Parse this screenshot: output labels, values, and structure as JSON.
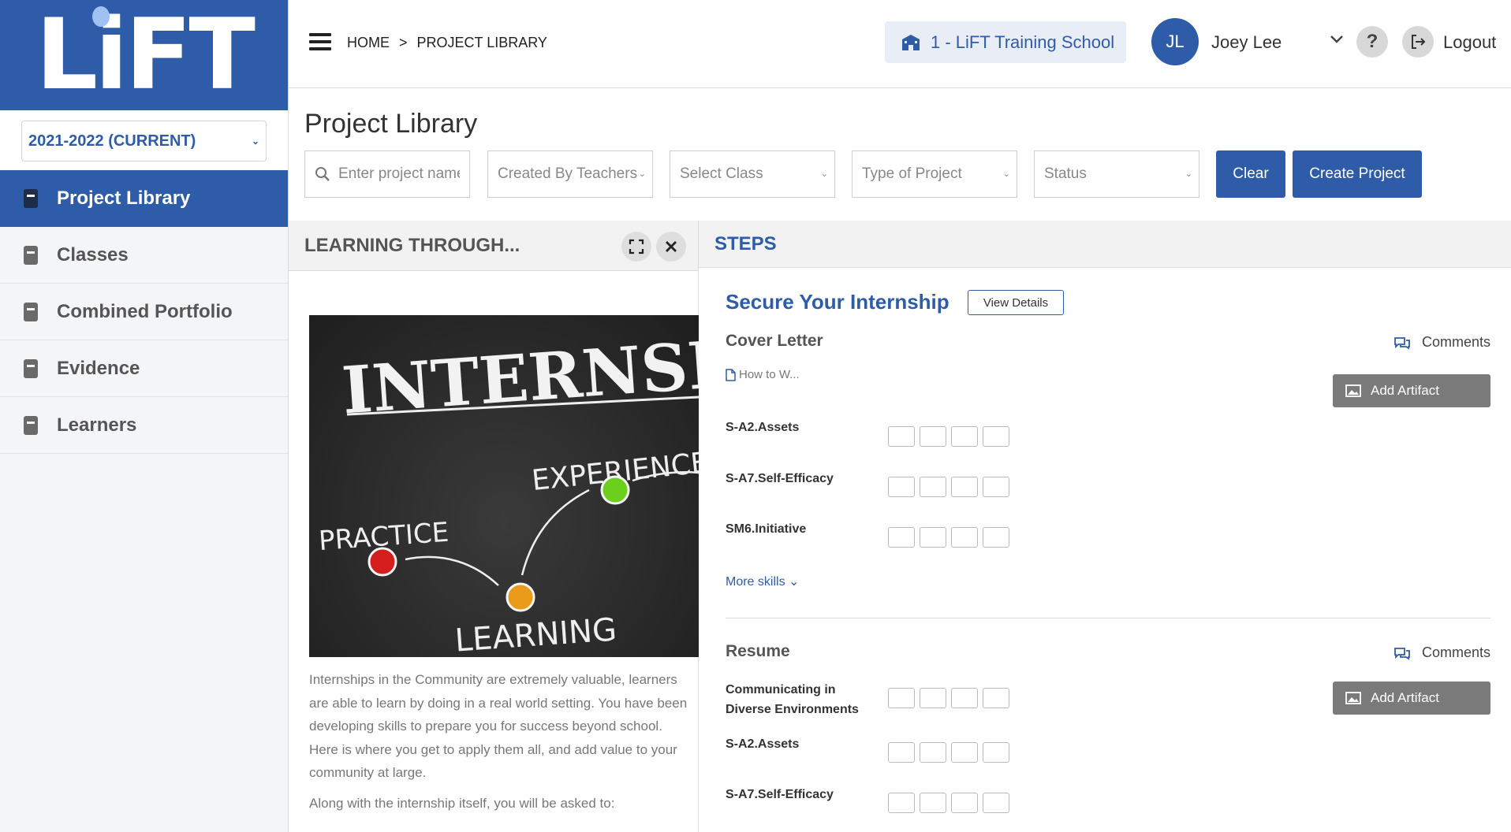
{
  "app": {
    "logo_text": "LiFT"
  },
  "sidebar": {
    "year": "2021-2022 (CURRENT)",
    "items": [
      {
        "label": "Project Library",
        "active": true
      },
      {
        "label": "Classes",
        "active": false
      },
      {
        "label": "Combined Portfolio",
        "active": false
      },
      {
        "label": "Evidence",
        "active": false
      },
      {
        "label": "Learners",
        "active": false
      }
    ]
  },
  "header": {
    "breadcrumb": [
      "HOME",
      ">",
      "PROJECT LIBRARY"
    ],
    "school": "1 - LiFT Training School",
    "user_initials": "JL",
    "user_name": "Joey Lee",
    "help": "?",
    "logout": "Logout"
  },
  "page": {
    "title": "Project Library",
    "filters": {
      "search_placeholder": "Enter project name",
      "created_by": "Created By Teachers",
      "class": "Select Class",
      "type": "Type of Project",
      "status": "Status"
    },
    "clear_label": "Clear",
    "create_label": "Create Project"
  },
  "left_panel": {
    "title": "LEARNING THROUGH...",
    "image_words": {
      "main": "INTERNSHIP",
      "practice": "PRACTICE",
      "experience": "EXPERIENCE",
      "learning": "LEARNING"
    },
    "description": "Internships in the Community are extremely valuable, learners are able to learn by doing in a real world setting. You have been developing skills to prepare you for success beyond school. Here is where you get to apply them all, and add value to your community at large.",
    "description2": "Along with the internship itself, you will be asked to:"
  },
  "steps": {
    "header": "STEPS",
    "step_title": "Secure Your Internship",
    "view_details": "View Details",
    "sections": [
      {
        "title": "Cover Letter",
        "comments": "Comments",
        "doc_link": "How to W...",
        "add_artifact": "Add Artifact",
        "skills": [
          "S-A2.Assets",
          "S-A7.Self-Efficacy",
          "SM6.Initiative"
        ],
        "more_skills": "More skills"
      },
      {
        "title": "Resume",
        "comments": "Comments",
        "add_artifact": "Add Artifact",
        "skills": [
          "Communicating in Diverse Environments",
          "S-A2.Assets",
          "S-A7.Self-Efficacy"
        ]
      }
    ]
  }
}
